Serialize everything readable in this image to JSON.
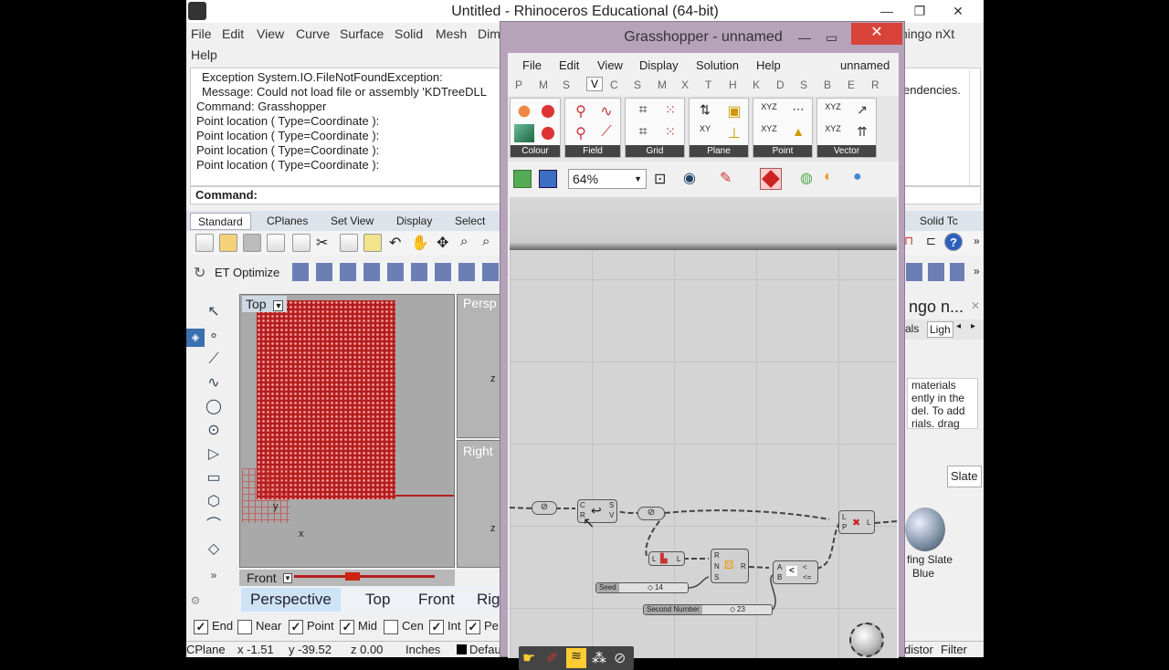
{
  "rhino": {
    "title": "Untitled - Rhinoceros Educational (64-bit)",
    "menu": [
      "File",
      "Edit",
      "View",
      "Curve",
      "Surface",
      "Solid",
      "Mesh",
      "Dim"
    ],
    "menu_right": "ningo nXt",
    "menu_help": "Help",
    "command_history": [
      "Exception System.IO.FileNotFoundException:",
      "Message: Could not load file or assembly 'KDTreeDLL",
      "",
      "Command: Grasshopper",
      "Point location ( Type=Coordinate ):",
      "Point location ( Type=Coordinate ):",
      "Point location ( Type=Coordinate ):",
      "Point location ( Type=Coordinate ):"
    ],
    "history_right_text": "endencies.",
    "command_prompt": "Command:",
    "toolbar_tabs": [
      "Standard",
      "CPlanes",
      "Set View",
      "Display",
      "Select"
    ],
    "toolbar_tab_right": "Solid Tc",
    "et_optimize": "ET Optimize",
    "viewports": {
      "top": "Top",
      "perspective": "Persp",
      "right": "Right",
      "front": "Front"
    },
    "axis_x": "x",
    "axis_y": "y",
    "axis_z": "z",
    "viewport_tabs": [
      "Perspective",
      "Top",
      "Front",
      "Rig"
    ],
    "osnaps": [
      {
        "label": "End",
        "checked": true
      },
      {
        "label": "Near",
        "checked": false
      },
      {
        "label": "Point",
        "checked": true
      },
      {
        "label": "Mid",
        "checked": true
      },
      {
        "label": "Cen",
        "checked": false
      },
      {
        "label": "Int",
        "checked": true
      },
      {
        "label": "Pe",
        "checked": true
      }
    ],
    "status": {
      "cplane": "CPlane",
      "x": "x -1.51",
      "y": "y -39.52",
      "z": "z 0.00",
      "units": "Inches",
      "layer": "Defau",
      "right1": "distor",
      "right2": "Filter"
    },
    "right_panel": {
      "title": "ngo n...",
      "tab1": "als",
      "tab2": "Ligh",
      "text": [
        "materials",
        "ently in the",
        "del. To add",
        "rials. drag"
      ],
      "slate": "Slate",
      "material": [
        "fing Slate",
        "Blue"
      ]
    }
  },
  "grasshopper": {
    "title": "Grasshopper - unnamed",
    "menu": [
      "File",
      "Edit",
      "View",
      "Display",
      "Solution",
      "Help"
    ],
    "doc_name": "unnamed",
    "category_tabs": [
      "P",
      "M",
      "S",
      "V",
      "C",
      "S",
      "M",
      "X",
      "T",
      "H",
      "K",
      "D",
      "S",
      "B",
      "E",
      "R"
    ],
    "active_category": "V",
    "ribbon_groups": [
      "Colour",
      "Field",
      "Grid",
      "Plane",
      "Point",
      "Vector"
    ],
    "zoom": "64%",
    "sliders": [
      {
        "name": "Seed",
        "value": "14"
      },
      {
        "name": "Second Number",
        "value": "23"
      }
    ],
    "components": {
      "num1_ports_in": "C",
      "num1_ports_in2": "R",
      "sv": "S",
      "v": "V",
      "l": "L",
      "rns": [
        "R",
        "N",
        "S"
      ],
      "r_out": "R",
      "ab": [
        "A",
        "B"
      ],
      "lt": "<",
      "lte": "<=",
      "lp": [
        "L",
        "P"
      ]
    }
  },
  "colors": {
    "grasshopper_frame": "#b6a3ba",
    "close_button": "#d8433a",
    "mesh_red": "#b51d1d"
  }
}
